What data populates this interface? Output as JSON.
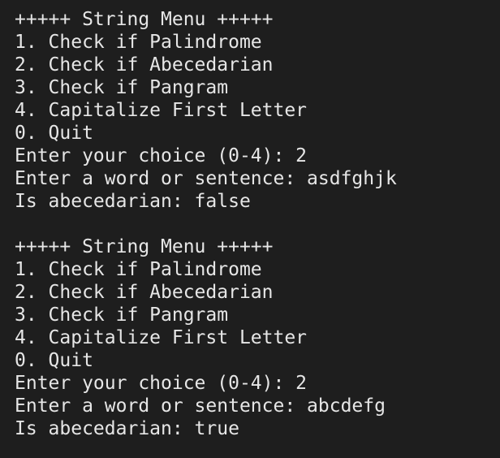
{
  "terminal": {
    "session1": {
      "menu_title": "+++++ String Menu +++++",
      "option1": "1. Check if Palindrome",
      "option2": "2. Check if Abecedarian",
      "option3": "3. Check if Pangram",
      "option4": "4. Capitalize First Letter",
      "option0": "0. Quit",
      "choice_prompt": "Enter your choice (0-4): 2",
      "input_prompt": "Enter a word or sentence: asdfghjk",
      "result": "Is abecedarian: false"
    },
    "session2": {
      "menu_title": "+++++ String Menu +++++",
      "option1": "1. Check if Palindrome",
      "option2": "2. Check if Abecedarian",
      "option3": "3. Check if Pangram",
      "option4": "4. Capitalize First Letter",
      "option0": "0. Quit",
      "choice_prompt": "Enter your choice (0-4): 2",
      "input_prompt": "Enter a word or sentence: abcdefg",
      "result": "Is abecedarian: true"
    }
  }
}
